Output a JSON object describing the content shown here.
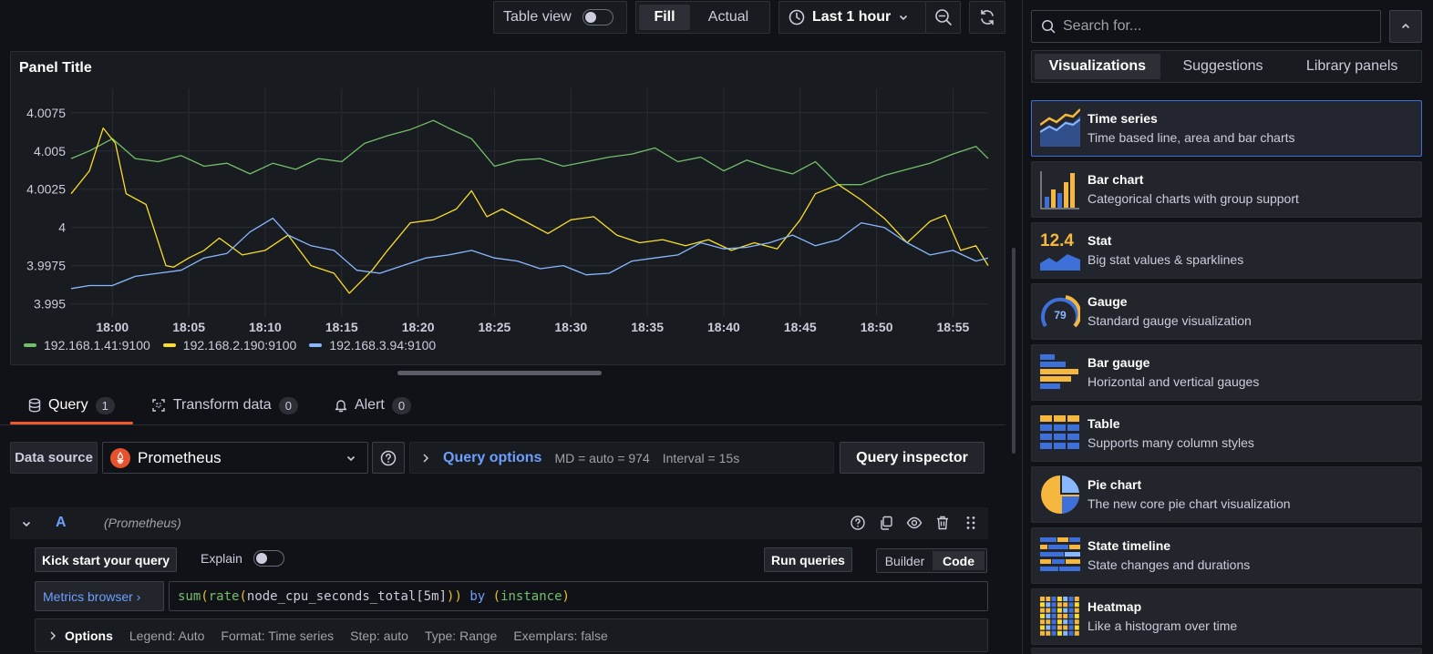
{
  "toolbar": {
    "table_view_label": "Table view",
    "fill_label": "Fill",
    "actual_label": "Actual",
    "time_range": "Last 1 hour"
  },
  "panel": {
    "title": "Panel Title"
  },
  "chart_data": {
    "type": "line",
    "x_ticks": [
      "18:00",
      "18:05",
      "18:10",
      "18:15",
      "18:20",
      "18:25",
      "18:30",
      "18:35",
      "18:40",
      "18:45",
      "18:50",
      "18:55"
    ],
    "y_ticks": [
      "4.0075",
      "4.005",
      "4.0025",
      "4",
      "3.9975",
      "3.995"
    ],
    "ylim": [
      3.9945,
      4.0085
    ],
    "x_range_minutes": [
      -2.7,
      57.3
    ],
    "grid": true,
    "legend_position": "bottom-left",
    "series": [
      {
        "name": "192.168.1.41:9100",
        "color": "#73bf69",
        "x": [
          -2.7,
          -1.5,
          0,
          1.5,
          3,
          4.5,
          6,
          7.5,
          9,
          10.5,
          12,
          13.5,
          15,
          16.5,
          18,
          19.5,
          21,
          22,
          23.5,
          25,
          26.5,
          28,
          29.5,
          31,
          32.5,
          34,
          35.5,
          37,
          38.5,
          40,
          41.5,
          43,
          44.5,
          46,
          47.5,
          49,
          50.5,
          52,
          53.5,
          55,
          56.5,
          57.3
        ],
        "values": [
          4.0045,
          4.005,
          4.0058,
          4.0045,
          4.0043,
          4.0047,
          4.004,
          4.0042,
          4.0035,
          4.0042,
          4.0038,
          4.0045,
          4.0043,
          4.0055,
          4.006,
          4.0064,
          4.007,
          4.0065,
          4.0058,
          4.004,
          4.0044,
          4.0045,
          4.004,
          4.0043,
          4.0046,
          4.0048,
          4.0052,
          4.0043,
          4.0046,
          4.0037,
          4.0044,
          4.0039,
          4.0035,
          4.0043,
          4.0028,
          4.0028,
          4.0034,
          4.0038,
          4.0042,
          4.0048,
          4.0053,
          4.0045
        ]
      },
      {
        "name": "192.168.2.190:9100",
        "color": "#fade2a",
        "x": [
          -2.7,
          -1.5,
          -0.6,
          0.2,
          0.9,
          2.2,
          3.5,
          4.0,
          5.0,
          6.0,
          7.0,
          8.5,
          10,
          11.5,
          13,
          14.5,
          15.5,
          17,
          18,
          19.5,
          21,
          22.5,
          23.5,
          24.5,
          25.5,
          27,
          28.5,
          30,
          31.5,
          33,
          34.5,
          36,
          37.5,
          39,
          40.5,
          42,
          43.5,
          45,
          46,
          47.5,
          49,
          50.5,
          52,
          53.5,
          54.5,
          55.5,
          56.5,
          57.3
        ],
        "values": [
          4.0022,
          4.0037,
          4.0065,
          4.0055,
          4.0022,
          4.0015,
          3.9975,
          3.9974,
          3.998,
          3.9985,
          3.9993,
          3.9982,
          3.9985,
          3.9995,
          3.9975,
          3.997,
          3.9957,
          3.9972,
          3.9985,
          4.0003,
          4.0005,
          4.0012,
          4.0024,
          4.0007,
          4.0012,
          4.0004,
          3.9996,
          4.0005,
          4.0007,
          3.9995,
          3.999,
          3.9992,
          3.9988,
          3.9992,
          3.9985,
          3.999,
          3.9986,
          4.0005,
          4.0022,
          4.0028,
          4.0018,
          4.0006,
          3.999,
          4.0004,
          4.0008,
          3.9985,
          3.9988,
          3.9975
        ]
      },
      {
        "name": "192.168.3.94:9100",
        "color": "#8ab8ff",
        "x": [
          -2.7,
          -1.5,
          0,
          1.5,
          3,
          4.5,
          6,
          7.5,
          9,
          10.5,
          11.5,
          13,
          14.5,
          16,
          17.5,
          19,
          20.5,
          22,
          23.5,
          25,
          26.5,
          28,
          29.5,
          31,
          32.5,
          34,
          35.5,
          37,
          38.5,
          40,
          41.5,
          43,
          44.5,
          46,
          47.5,
          49,
          50.5,
          52,
          53.5,
          55,
          56.5,
          57.3
        ],
        "values": [
          3.996,
          3.9962,
          3.9962,
          3.9968,
          3.997,
          3.9972,
          3.998,
          3.9983,
          3.9997,
          4.0006,
          3.9995,
          3.9988,
          3.9985,
          3.9972,
          3.997,
          3.9975,
          3.998,
          3.9982,
          3.9985,
          3.998,
          3.9978,
          3.9973,
          3.9975,
          3.9969,
          3.997,
          3.9978,
          3.998,
          3.9982,
          3.999,
          3.9986,
          3.9987,
          3.999,
          3.9995,
          3.9988,
          3.9992,
          4.0003,
          4.0,
          3.999,
          3.9982,
          3.9985,
          3.9978,
          3.998
        ]
      }
    ]
  },
  "query_tabs": [
    {
      "label": "Query",
      "count": "1"
    },
    {
      "label": "Transform data",
      "count": "0"
    },
    {
      "label": "Alert",
      "count": "0"
    }
  ],
  "datasource": {
    "label": "Data source",
    "name": "Prometheus"
  },
  "query_options": {
    "title": "Query options",
    "md": "MD = auto = 974",
    "interval": "Interval = 15s",
    "inspector": "Query inspector"
  },
  "query": {
    "ref": "A",
    "ds_name": "(Prometheus)",
    "kick_start": "Kick start your query",
    "explain": "Explain",
    "run": "Run queries",
    "builder": "Builder",
    "code_mode": "Code",
    "metrics_browser": "Metrics browser ›",
    "expr": {
      "fn1": "sum",
      "p1": "(",
      "fn2": "rate",
      "p2": "(",
      "metric": "node_cpu_seconds_total[5m]",
      "p3": "))",
      "kw": " by ",
      "p4": "(",
      "label": "instance",
      "p5": ")"
    },
    "options": {
      "title": "Options",
      "legend": "Legend: Auto",
      "format": "Format: Time series",
      "step": "Step: auto",
      "type": "Type: Range",
      "exemplars": "Exemplars: false"
    }
  },
  "sidebar": {
    "search_placeholder": "Search for...",
    "tabs": [
      "Visualizations",
      "Suggestions",
      "Library panels"
    ],
    "visualizations": [
      {
        "name": "Time series",
        "desc": "Time based line, area and bar charts",
        "icon": "time-series-icon"
      },
      {
        "name": "Bar chart",
        "desc": "Categorical charts with group support",
        "icon": "bar-chart-icon"
      },
      {
        "name": "Stat",
        "desc": "Big stat values & sparklines",
        "icon": "stat-icon",
        "icon_text": "12.4"
      },
      {
        "name": "Gauge",
        "desc": "Standard gauge visualization",
        "icon": "gauge-icon",
        "icon_text": "79"
      },
      {
        "name": "Bar gauge",
        "desc": "Horizontal and vertical gauges",
        "icon": "bar-gauge-icon"
      },
      {
        "name": "Table",
        "desc": "Supports many column styles",
        "icon": "table-icon"
      },
      {
        "name": "Pie chart",
        "desc": "The new core pie chart visualization",
        "icon": "pie-chart-icon"
      },
      {
        "name": "State timeline",
        "desc": "State changes and durations",
        "icon": "state-timeline-icon"
      },
      {
        "name": "Heatmap",
        "desc": "Like a histogram over time",
        "icon": "heatmap-icon"
      }
    ]
  }
}
